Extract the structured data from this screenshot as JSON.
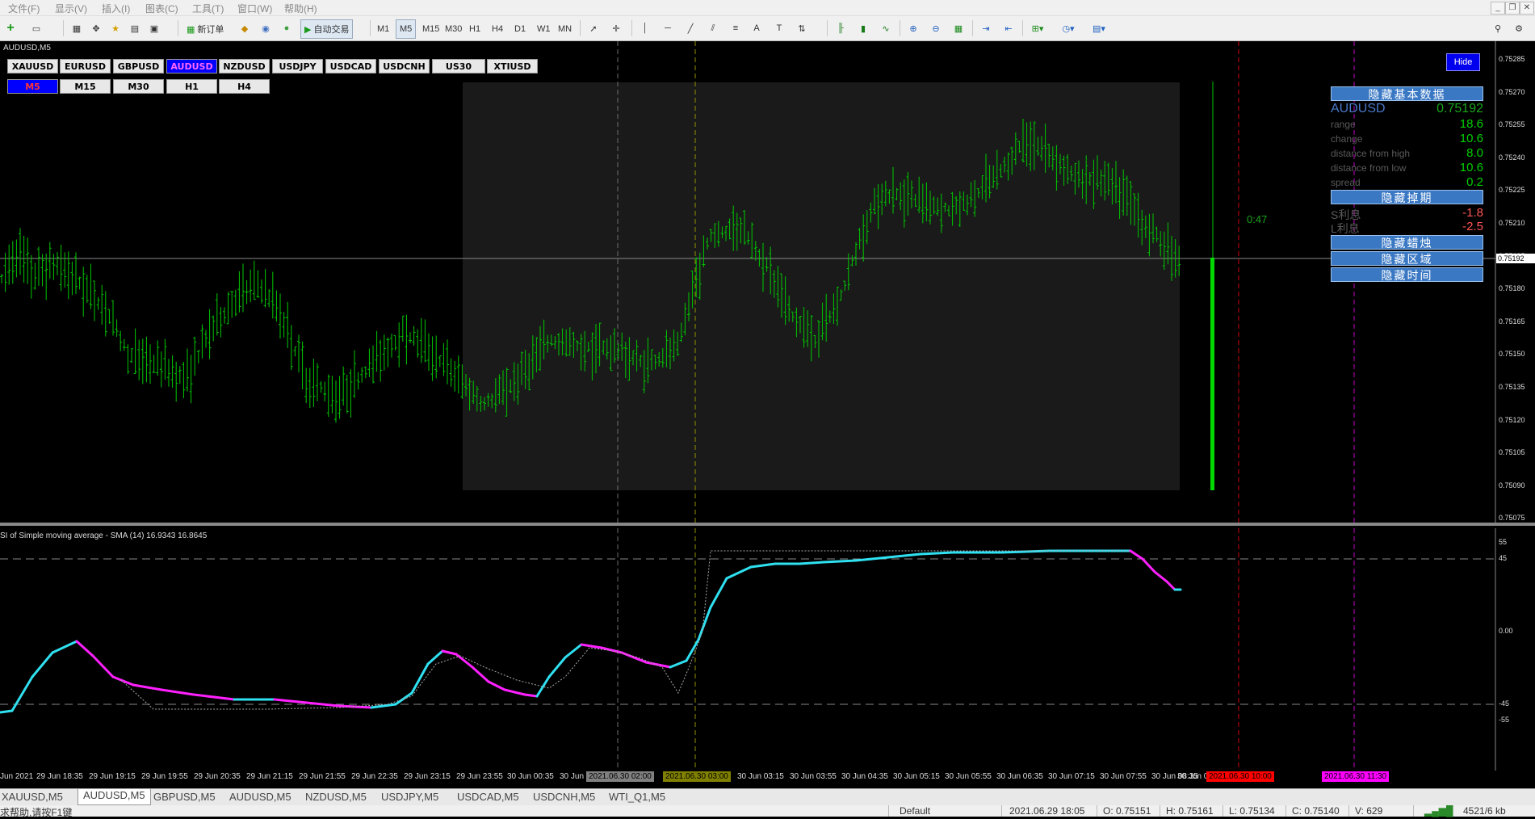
{
  "menu": [
    "文件(F)",
    "显示(V)",
    "插入(I)",
    "图表(C)",
    "工具(T)",
    "窗口(W)",
    "帮助(H)"
  ],
  "toolbar": {
    "new_order": "新订单",
    "auto_trading": "自动交易",
    "timeframes": [
      "M1",
      "M5",
      "M15",
      "M30",
      "H1",
      "H4",
      "D1",
      "W1",
      "MN"
    ],
    "active_timeframe": "M5"
  },
  "chart": {
    "title": "AUDUSD,M5",
    "symbol_buttons": [
      "XAUUSD",
      "EURUSD",
      "GBPUSD",
      "AUDUSD",
      "NZDUSD",
      "USDJPY",
      "USDCAD",
      "USDCNH",
      "US30",
      "XTIUSD"
    ],
    "active_symbol": "AUDUSD",
    "timeframe_buttons": [
      "M5",
      "M15",
      "M30",
      "H1",
      "H4"
    ],
    "active_tf": "M5",
    "hide_button": "Hide",
    "timer": "0:47",
    "current_price": "0.75192",
    "bar_color": "#00c800",
    "price_axis": [
      "0.75285",
      "0.75270",
      "0.75255",
      "0.75240",
      "0.75225",
      "0.75210",
      "0.75195",
      "0.75180",
      "0.75165",
      "0.75150",
      "0.75135",
      "0.75120",
      "0.75105",
      "0.75090",
      "0.75075"
    ],
    "time_axis": [
      "Jun 2021",
      "29 Jun 18:35",
      "29 Jun 19:15",
      "29 Jun 19:55",
      "29 Jun 20:35",
      "29 Jun 21:15",
      "29 Jun 21:55",
      "29 Jun 22:35",
      "29 Jun 23:15",
      "29 Jun 23:55",
      "30 Jun 00:35",
      "30 Jun 0",
      "5",
      "30 Jun 03:15",
      "30 Jun 03:55",
      "30 Jun 04:35",
      "30 Jun 05:15",
      "30 Jun 05:55",
      "30 Jun 06:35",
      "30 Jun 07:15",
      "30 Jun 07:55",
      "30 Jun 08:35",
      "30 Jun 0"
    ],
    "time_highlights": [
      {
        "text": "2021.06.30 02:00",
        "bg": "#808080",
        "fg": "#000"
      },
      {
        "text": "2021.06.30 03:00",
        "bg": "#808000",
        "fg": "#000"
      },
      {
        "text": "2021.06.30 10:00",
        "bg": "#ff0000",
        "fg": "#000"
      },
      {
        "text": "2021.06.30 11:30",
        "bg": "#ff00ff",
        "fg": "#000"
      }
    ]
  },
  "panel": {
    "hide_basic": "隐藏基本数据",
    "symbol": "AUDUSD",
    "price": "0.75192",
    "rows": [
      {
        "label": "range",
        "value": "18.6"
      },
      {
        "label": "change",
        "value": "10.6"
      },
      {
        "label": "distance from high",
        "value": "8.0"
      },
      {
        "label": "distance from low",
        "value": "10.6"
      },
      {
        "label": "spread",
        "value": "0.2"
      }
    ],
    "hide_swap": "隐藏掉期",
    "swap_rows": [
      {
        "label": "S利息",
        "value": "-1.8"
      },
      {
        "label": "L利息",
        "value": "-2.5"
      }
    ],
    "hide_candles": "隐藏蜡烛",
    "hide_zone": "隐藏区域",
    "hide_time": "隐藏时间"
  },
  "indicator": {
    "title": "SI of Simple moving average - SMA (14) 16.9343 16.8645",
    "axis": [
      "55",
      "45",
      "0.00",
      "-45",
      "-55"
    ],
    "colors": {
      "up": "#2fe0f0",
      "down": "#ff20ff",
      "signal": "#aaaaaa"
    }
  },
  "tabs": [
    "XAUUSD,M5",
    "AUDUSD,M5",
    "GBPUSD,M5",
    "AUDUSD,M5",
    "NZDUSD,M5",
    "USDJPY,M5",
    "USDCAD,M5",
    "USDCNH,M5",
    "WTI_Q1,M5"
  ],
  "active_tab": 1,
  "status": {
    "help": "求帮助,请按F1键",
    "profile": "Default",
    "datetime": "2021.06.29 18:05",
    "open": "O: 0.75151",
    "high": "H: 0.75161",
    "low": "L: 0.75134",
    "close": "C: 0.75140",
    "volume": "V: 629",
    "traffic": "4521/6 kb"
  }
}
